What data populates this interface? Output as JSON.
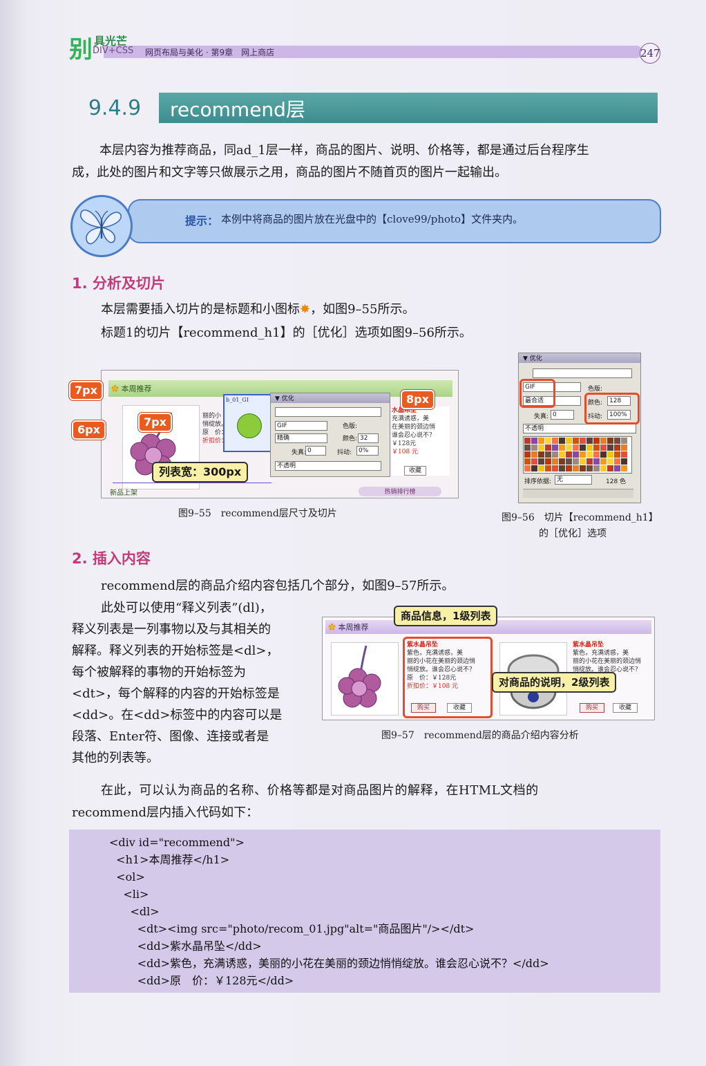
{
  "header": {
    "brand_char": "别",
    "brand_sub": "具光芒",
    "brand_line": "DIV+CSS",
    "running_title": "网页布局与美化 · 第9章　网上商店",
    "page_number": "247"
  },
  "section": {
    "number": "9.4.9",
    "title": "recommend层",
    "intro_line1": "本层内容为推荐商品，同ad_1层一样，商品的图片、说明、价格等，都是通过后台程序生",
    "intro_line2": "成，此处的图片和文字等只做展示之用，商品的图片不随首页的图片一起输出。"
  },
  "tip": {
    "label": "提示：",
    "text": "本例中将商品的图片放在光盘中的【clove99/photo】文件夹内。"
  },
  "part1": {
    "heading": "1. 分析及切片",
    "line1": "本层需要插入切片的是标题和小图标",
    "line1_end": "，如图9–55所示。",
    "line2": "标题1的切片【recommend_h1】的［优化］选项如图9–56所示。"
  },
  "fig55": {
    "caption": "图9–55　recommend层尺寸及切片",
    "label_7px_a": "7px",
    "label_6px": "6px",
    "label_7px_b": "7px",
    "label_8px": "8px",
    "label_width": "列表宽：300px",
    "tab": "本周推荐",
    "slice_name": "b_01_GI",
    "panel_title": "▼ 优化",
    "format": "GIF",
    "palette": "精确",
    "colors_label": "颜色:",
    "colors_value": "32",
    "loss_label": "失真:",
    "loss_value": "0",
    "dither_label": "抖动:",
    "dither_value": "0%",
    "matte_label": "色版:",
    "transparency": "不透明",
    "product_name": "水晶吊坠",
    "desc_lines": [
      "充满诱惑，美",
      "在美丽的颈边悄",
      "谁会忍心说不？"
    ],
    "left_desc": [
      "丽的小",
      "悄绽放。谁会忍心说不?"
    ],
    "price_orig": "原　价：￥128元",
    "price_disc": "折扣价：￥108 元",
    "price_orig_r": "￥128元",
    "price_disc_r": "￥108 元",
    "collect": "收藏",
    "bottom_tab": "新品上架",
    "bottom_tab_r": "热销排行榜"
  },
  "fig56": {
    "caption_line1": "图9–56　切片【recommend_h1】",
    "caption_line2": "的［优化］选项",
    "panel_title": "▼ 优化",
    "format": "GIF",
    "palette": "最合适",
    "matte_label": "色版:",
    "colors_label": "颜色:",
    "colors_value": "128",
    "loss_label": "失真:",
    "loss_value": "0",
    "dither_label": "抖动:",
    "dither_value": "100%",
    "transparency": "不透明",
    "sort_label": "排序依据:",
    "sort_value": "无",
    "color_count": "128 色"
  },
  "part2": {
    "heading": "2. 插入内容",
    "line1": "recommend层的商品介绍内容包括几个部分，如图9–57所示。",
    "wrap_lines": [
      "此处可以使用“释义列表”(dl)，",
      "释义列表是一列事物以及与其相关的",
      "解释。释义列表的开始标签是<dl>，",
      "每个被解释的事物的开始标签为",
      "<dt>，每个解释的内容的开始标签是",
      "<dd>。在<dd>标签中的内容可以是",
      "段落、Enter符、图像、连接或者是",
      "其他的列表等。"
    ],
    "line_last1": "在此，可以认为商品的名称、价格等都是对商品图片的解释，在HTML文档的",
    "line_last2": "recommend层内插入代码如下："
  },
  "fig57": {
    "caption": "图9–57　recommend层的商品介绍内容分析",
    "tab": "本周推荐",
    "callout_top": "商品信息，1级列表",
    "callout_mid": "对商品的说明，2级列表",
    "product_name": "紫水晶吊坠",
    "desc": [
      "紫色，充满诱惑，美",
      "丽的小花在美丽的颈边悄",
      "悄绽放。谁会忍心说不？"
    ],
    "price_orig": "原　价：￥128元",
    "price_disc": "折扣价：￥108 元",
    "buy": "购买",
    "collect": "收藏",
    "product_name_r": "紫水晶吊坠",
    "desc_r": [
      "紫色，充满诱惑，美",
      "丽的小花在美丽的颈边悄",
      "悄绽放。谁会忍心说不？"
    ],
    "buy_r": "购买",
    "collect_r": "收藏"
  },
  "code": {
    "lines": [
      "<div id=\"recommend\">",
      "  <h1>本周推荐</h1>",
      "  <ol>",
      "    <li>",
      "      <dl>",
      "        <dt><img src=\"photo/recom_01.jpg\"alt=\"商品图片\"/></dt>",
      "        <dd>紫水晶吊坠</dd>",
      "        <dd>紫色，充满诱惑，美丽的小花在美丽的颈边悄悄绽放。谁会忍心说不？</dd>",
      "        <dd>原　价：￥128元</dd>"
    ]
  },
  "colors": {
    "accent_teal": "#3f8c8f",
    "heading_pink": "#c23a78",
    "callout_orange": "#e95b21",
    "code_bg": "#d5c9ea"
  }
}
